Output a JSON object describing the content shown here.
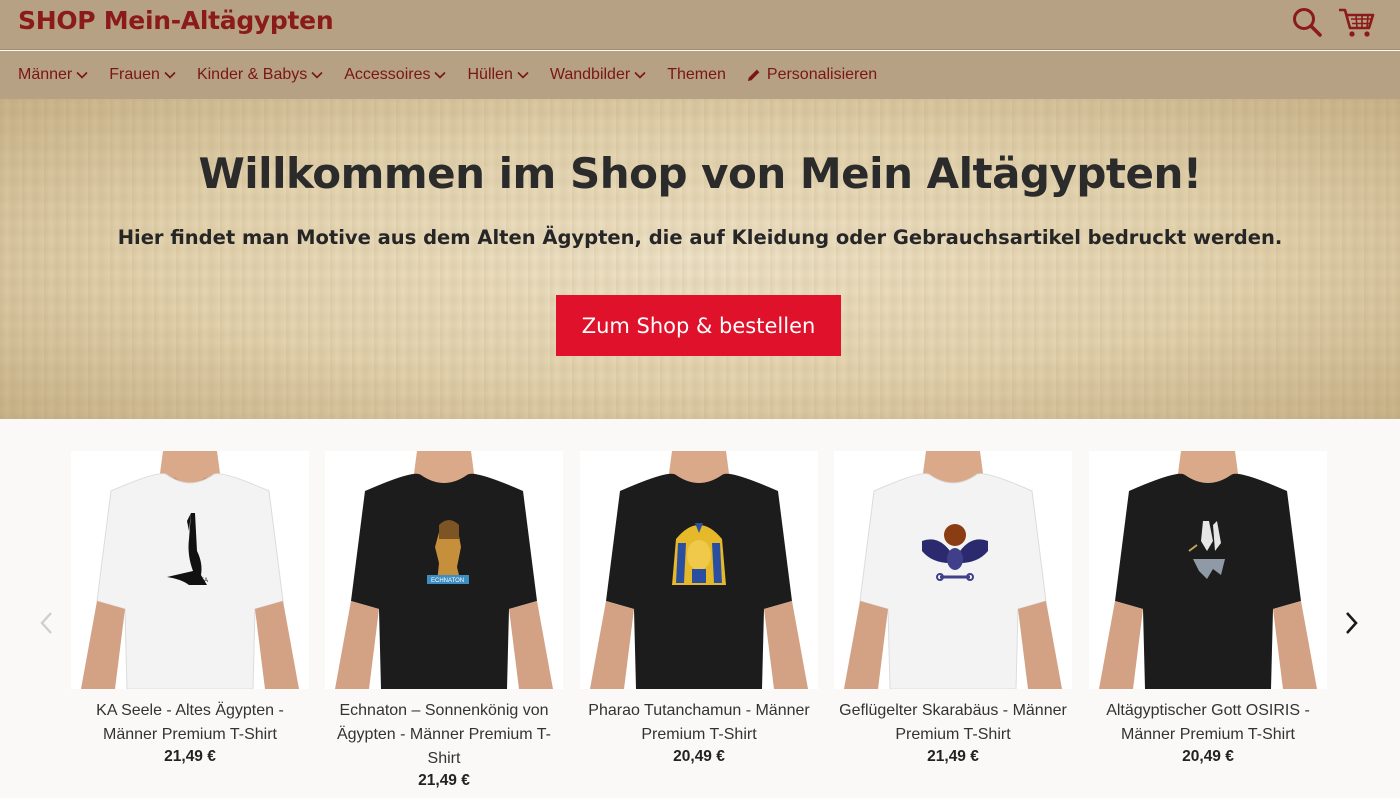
{
  "header": {
    "brand": "SHOP Mein-Altägypten",
    "accent_color": "#8b1a1a",
    "bar_color": "#b6a184",
    "icons": [
      "search-icon",
      "cart-icon"
    ]
  },
  "nav": {
    "items": [
      {
        "label": "Männer",
        "has_dropdown": true
      },
      {
        "label": "Frauen",
        "has_dropdown": true
      },
      {
        "label": "Kinder & Babys",
        "has_dropdown": true
      },
      {
        "label": "Accessoires",
        "has_dropdown": true
      },
      {
        "label": "Hüllen",
        "has_dropdown": true
      },
      {
        "label": "Wandbilder",
        "has_dropdown": true
      },
      {
        "label": "Themen",
        "has_dropdown": false
      },
      {
        "label": "Personalisieren",
        "has_dropdown": false,
        "icon": "pencil-icon"
      }
    ]
  },
  "hero": {
    "title": "Willkommen im Shop von Mein Altägypten!",
    "subtitle": "Hier findet man Motive aus dem Alten Ägypten, die auf Kleidung oder Gebrauchsartikel bedruckt werden.",
    "cta_label": "Zum Shop & bestellen",
    "cta_color": "#e0112b"
  },
  "products": {
    "items": [
      {
        "title": "KA Seele - Altes Ägypten - Männer Premium T-Shirt",
        "price": "21,49 €",
        "shirt_color": "white",
        "motif": "ka-bird-motif"
      },
      {
        "title": "Echnaton – Sonnenkönig von Ägypten - Männer Premium T-Shirt",
        "price": "21,49 €",
        "shirt_color": "black",
        "motif": "echnaton-statue-motif",
        "motif_text": "ECHNATON"
      },
      {
        "title": "Pharao Tutanchamun - Männer Premium T-Shirt",
        "price": "20,49 €",
        "shirt_color": "black",
        "motif": "tutankhamun-mask-motif"
      },
      {
        "title": "Geflügelter Skarabäus - Männer Premium T-Shirt",
        "price": "21,49 €",
        "shirt_color": "white",
        "motif": "winged-scarab-motif"
      },
      {
        "title": "Altägyptischer Gott OSIRIS - Männer Premium T-Shirt",
        "price": "20,49 €",
        "shirt_color": "black",
        "motif": "osiris-motif"
      }
    ],
    "icons": [
      "chevron-left-icon",
      "chevron-right-icon"
    ]
  }
}
